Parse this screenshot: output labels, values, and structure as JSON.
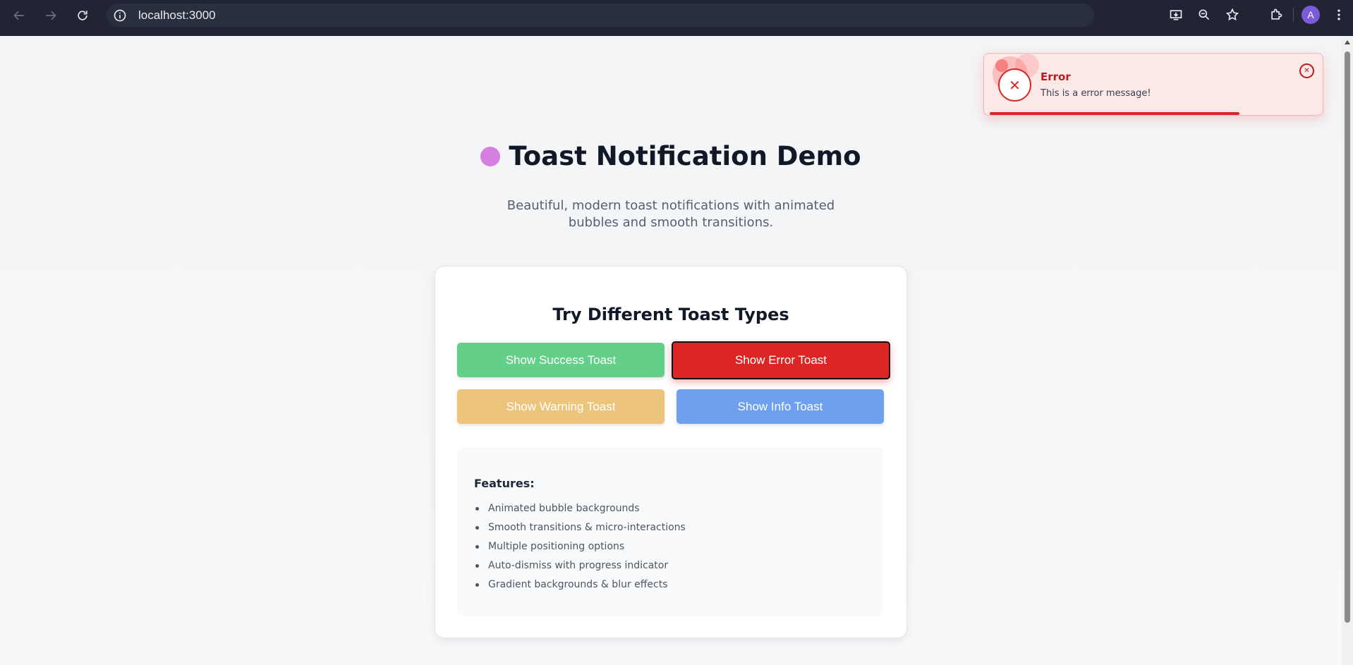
{
  "browser": {
    "url": "localhost:3000",
    "avatar_letter": "A"
  },
  "page": {
    "title": "Toast Notification Demo",
    "subtitle_line1": "Beautiful, modern toast notifications with animated",
    "subtitle_line2": "bubbles and smooth transitions.",
    "card": {
      "heading": "Try Different Toast Types",
      "buttons": {
        "success": "Show Success Toast",
        "error": "Show Error Toast",
        "warning": "Show Warning Toast",
        "info": "Show Info Toast"
      },
      "features": {
        "heading": "Features:",
        "items": [
          "Animated bubble backgrounds",
          "Smooth transitions & micro-interactions",
          "Multiple positioning options",
          "Auto-dismiss with progress indicator",
          "Gradient backgrounds & blur effects"
        ]
      }
    }
  },
  "toast": {
    "type": "error",
    "title": "Error",
    "message": "This is a error message!",
    "icon": "close-icon",
    "close_icon": "close-icon",
    "progress": 0.75
  },
  "colors": {
    "success": "#63cf88",
    "error": "#dc2626",
    "warning": "#ecc47b",
    "info": "#6fa0f0",
    "title_dot": "#d67fe0"
  }
}
